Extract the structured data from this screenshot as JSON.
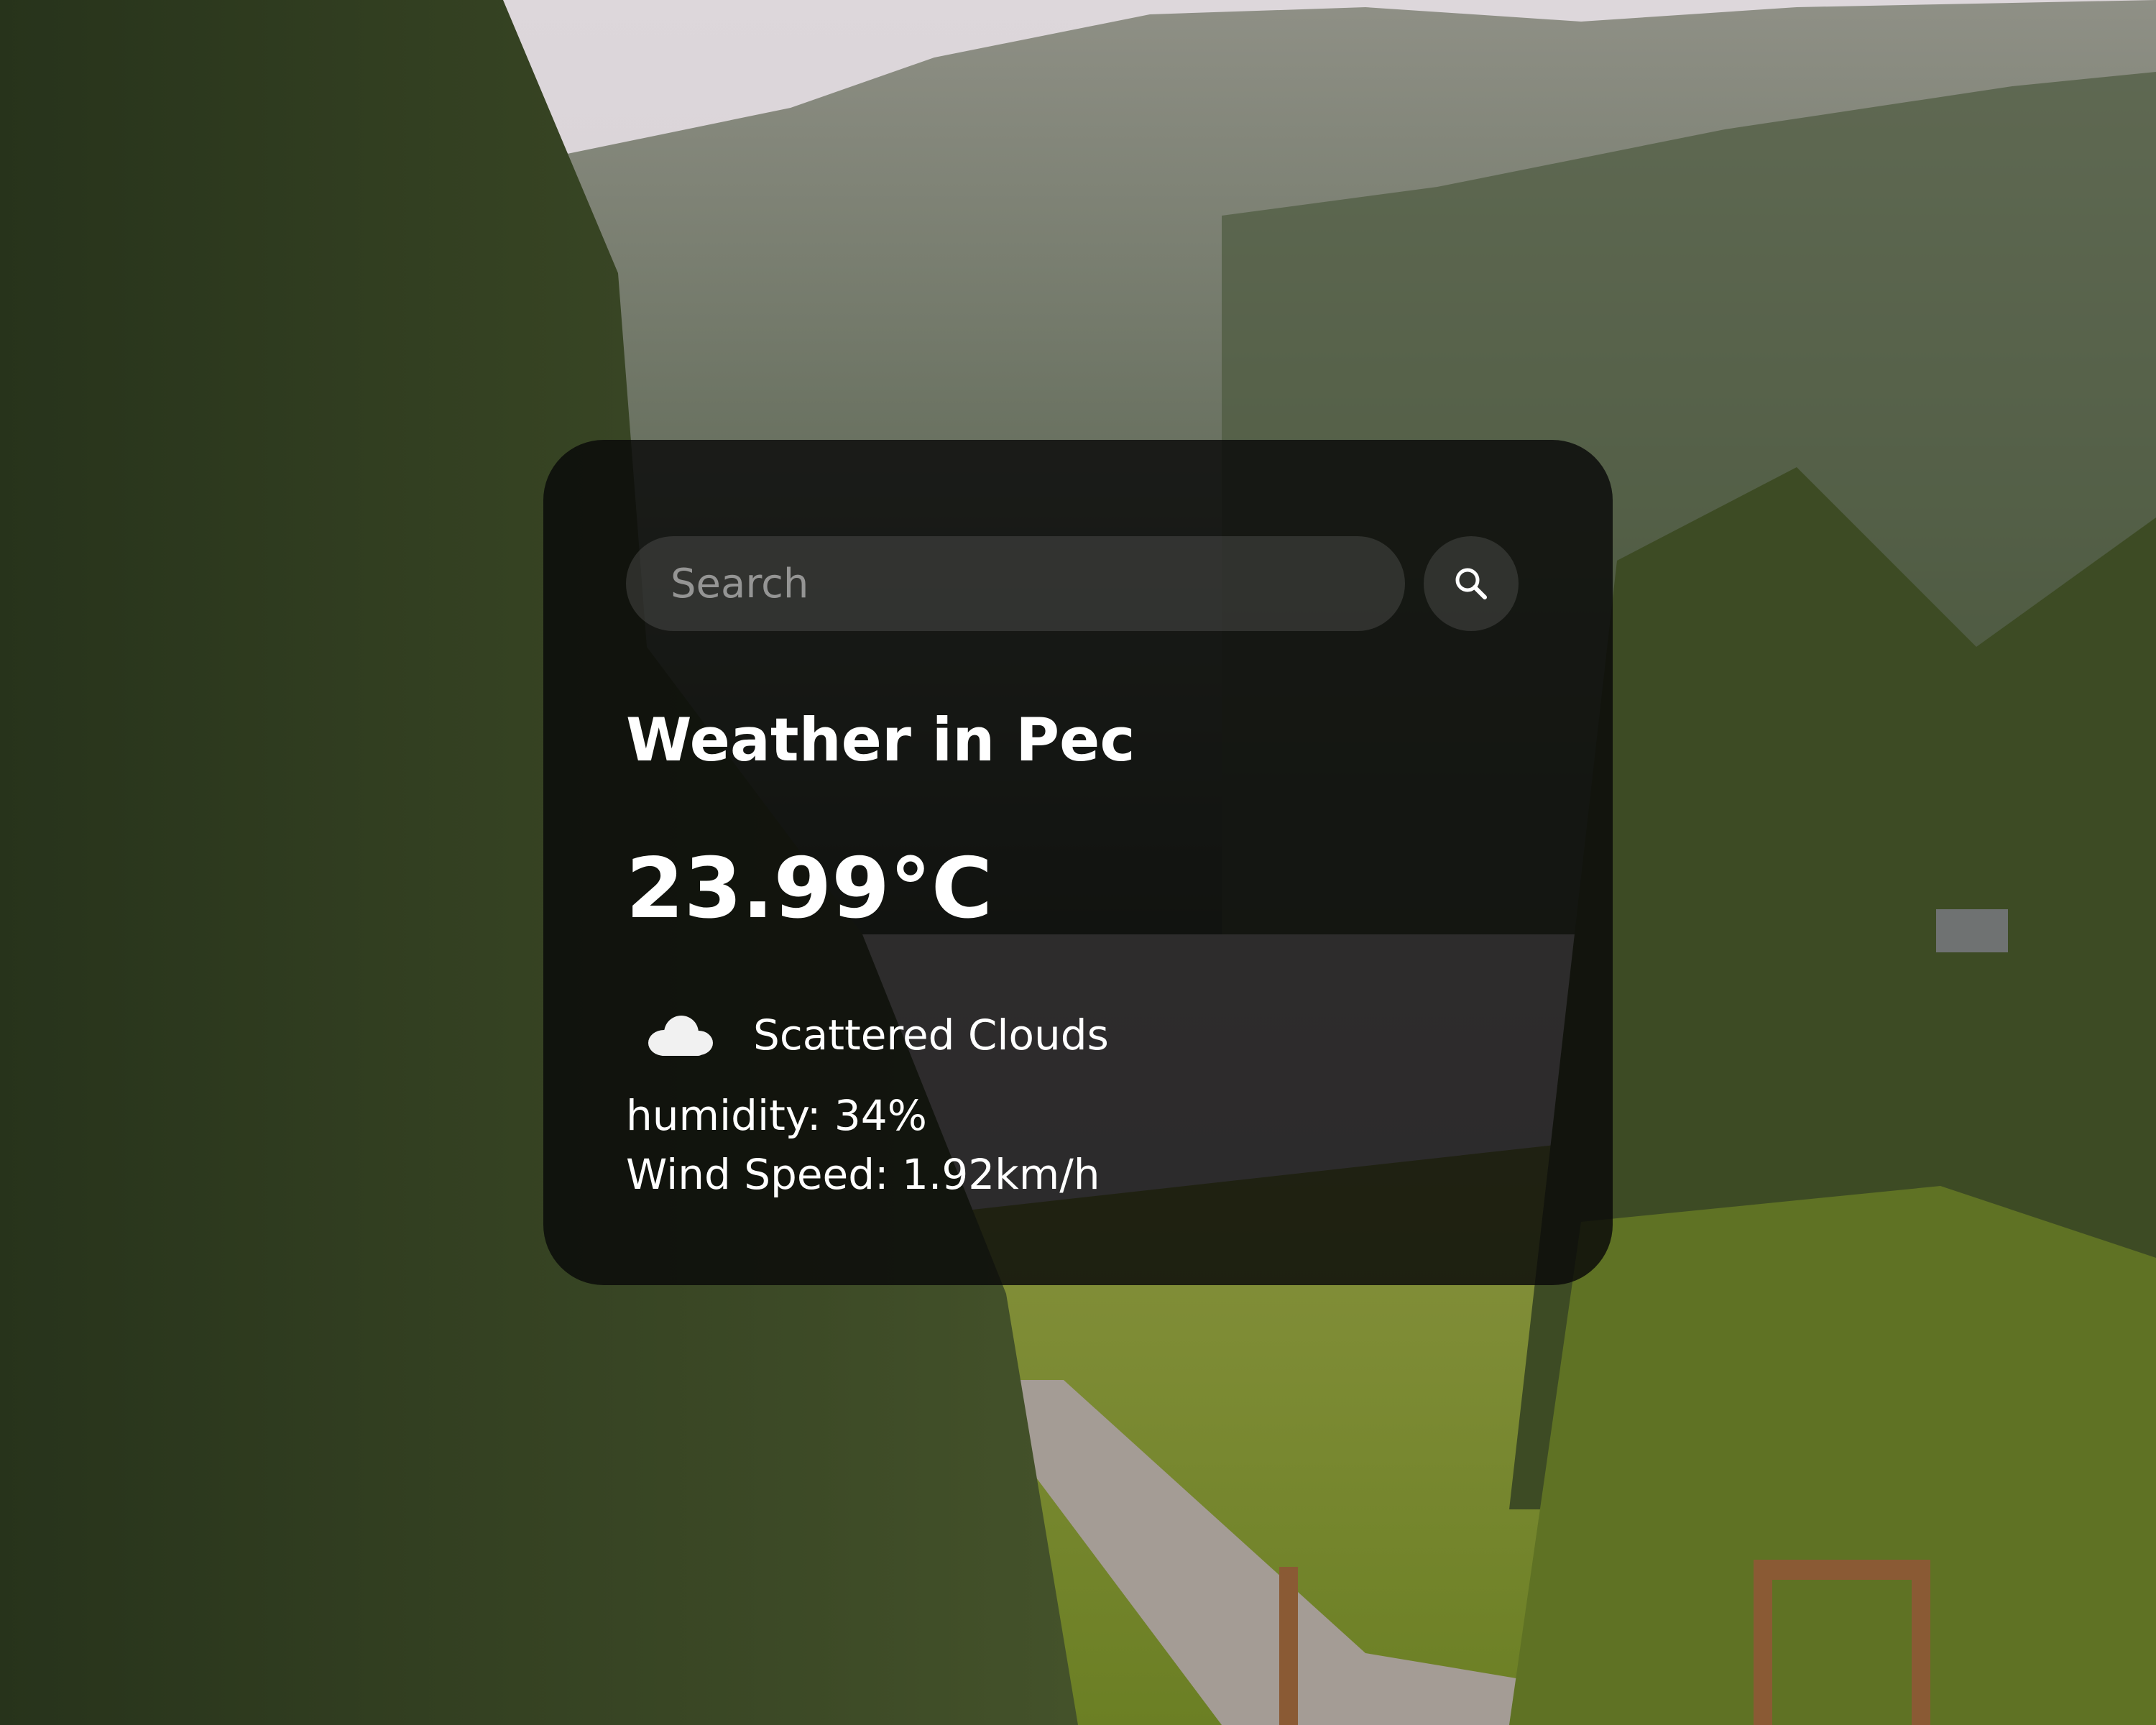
{
  "search": {
    "placeholder": "Search",
    "button_icon": "search-icon"
  },
  "weather": {
    "title": "Weather in Pec",
    "temperature": "23.99°C",
    "condition": {
      "icon": "cloud-icon",
      "label": "Scattered Clouds"
    },
    "humidity": "humidity: 34%",
    "wind_speed": "Wind Speed: 1.92km/h"
  },
  "colors": {
    "card_background": "#080808",
    "text": "#ffffff",
    "input_background": "#5a5a5a",
    "placeholder": "#b8b8b8"
  }
}
